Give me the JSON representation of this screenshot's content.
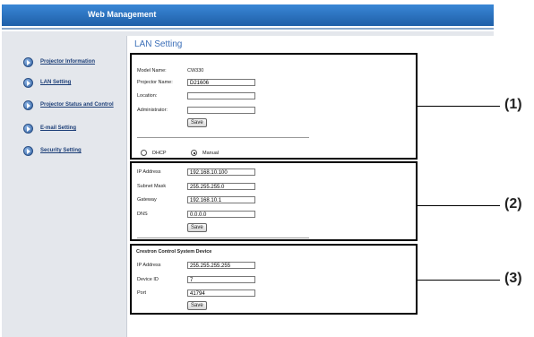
{
  "header": {
    "title": "Web Management"
  },
  "sidebar": {
    "items": [
      {
        "label": "Projector Information"
      },
      {
        "label": "LAN Setting"
      },
      {
        "label": "Projector Status and Control"
      },
      {
        "label": "E-mail Setting"
      },
      {
        "label": "Security Setting"
      }
    ]
  },
  "page": {
    "title": "LAN Setting"
  },
  "panel1": {
    "model_name_label": "Model Name:",
    "model_name_value": "CW330",
    "projector_name_label": "Projector Name:",
    "projector_name_value": "D21606",
    "location_label": "Location:",
    "location_value": "",
    "administrator_label": "Administrator:",
    "administrator_value": "",
    "save_label": "Save",
    "dhcp_label": "DHCP",
    "manual_label": "Manual",
    "selected_mode": "Manual"
  },
  "panel2": {
    "ip_label": "IP Address",
    "ip_value": "192.168.10.100",
    "subnet_label": "Subnet Mask",
    "subnet_value": "255.255.255.0",
    "gateway_label": "Gateway",
    "gateway_value": "192.168.10.1",
    "dns_label": "DNS",
    "dns_value": "0.0.0.0",
    "save_label": "Save"
  },
  "panel3": {
    "title": "Crestron Control System Device",
    "ip_label": "IP Address",
    "ip_value": "255.255.255.255",
    "device_id_label": "Device ID",
    "device_id_value": "7",
    "port_label": "Port",
    "port_value": "41794",
    "save_label": "Save"
  },
  "callouts": [
    "(1)",
    "(2)",
    "(3)"
  ]
}
